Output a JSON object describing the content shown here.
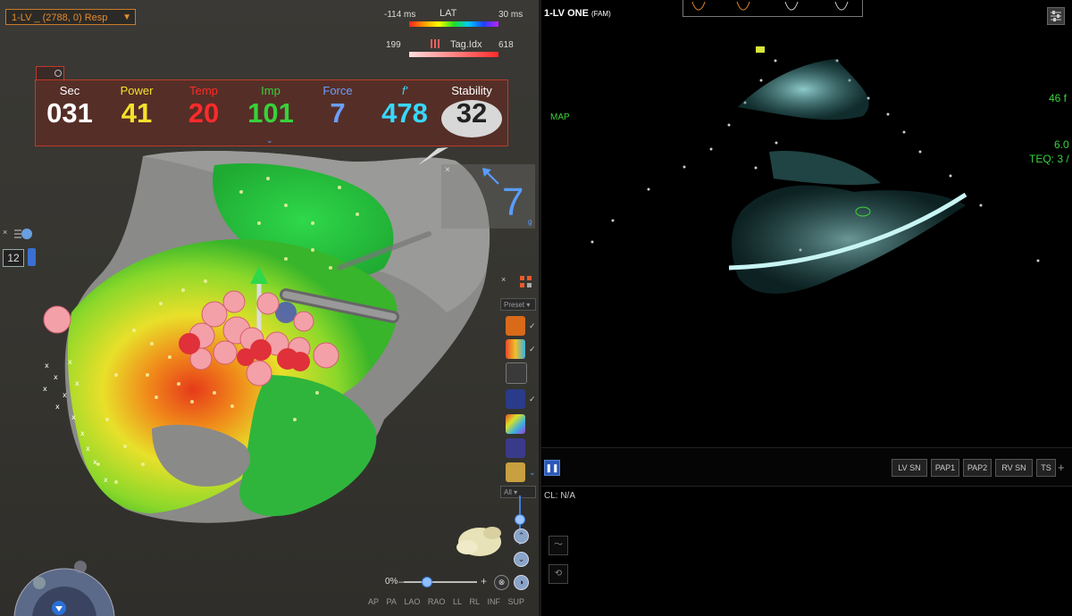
{
  "left_panel": {
    "map_selector": "1-LV _ (2788, 0) Resp",
    "lat_legend": {
      "min": "-114 ms",
      "title": "LAT",
      "max": "30 ms"
    },
    "tag_legend": {
      "min": "199",
      "title": "Tag.Idx",
      "max": "618"
    },
    "ablation": {
      "metrics": [
        {
          "label": "Sec",
          "value": "031",
          "color": "#ffffff"
        },
        {
          "label": "Power",
          "value": "41",
          "color": "#f5e12a"
        },
        {
          "label": "Temp",
          "value": "20",
          "color": "#ff2a2a"
        },
        {
          "label": "Imp",
          "value": "101",
          "color": "#37d23a"
        },
        {
          "label": "Force",
          "value": "7",
          "color": "#6a9fff"
        },
        {
          "label": "f'",
          "value": "478",
          "color": "#38d8ff"
        },
        {
          "label": "Stability",
          "value": "32",
          "color": "#222222"
        }
      ]
    },
    "force_value": "7",
    "force_unit": "g",
    "side_value": "12",
    "palette": {
      "preset": "Preset",
      "all": "All"
    },
    "zoom": "0%",
    "views": [
      "AP",
      "PA",
      "LAO",
      "RAO",
      "LL",
      "RL",
      "INF",
      "SUP"
    ]
  },
  "right_panel": {
    "title": "1-LV ONE",
    "title_suffix": "(FAM)",
    "map_label": "MAP",
    "right_labels": {
      "top": "46 f",
      "mid": "6.0",
      "teq": "TEQ: 3 /"
    },
    "controls": [
      "LV SN",
      "PAP1",
      "PAP2",
      "RV SN",
      "TS"
    ],
    "cycle_length": "CL: N/A"
  }
}
